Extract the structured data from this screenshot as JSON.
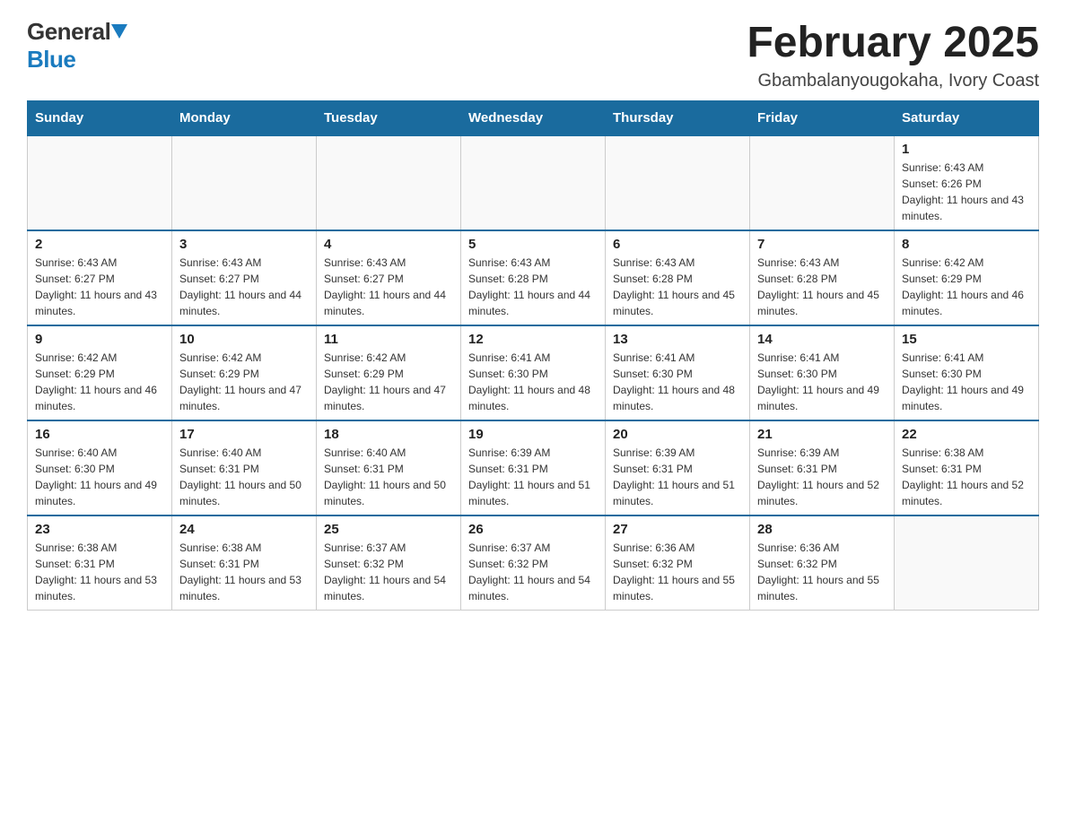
{
  "header": {
    "logo": {
      "general": "General",
      "blue": "Blue",
      "triangle_color": "#1a7bbf"
    },
    "title": "February 2025",
    "location": "Gbambalanyougokaha, Ivory Coast"
  },
  "calendar": {
    "days_of_week": [
      "Sunday",
      "Monday",
      "Tuesday",
      "Wednesday",
      "Thursday",
      "Friday",
      "Saturday"
    ],
    "weeks": [
      {
        "days": [
          {
            "date": "",
            "info": ""
          },
          {
            "date": "",
            "info": ""
          },
          {
            "date": "",
            "info": ""
          },
          {
            "date": "",
            "info": ""
          },
          {
            "date": "",
            "info": ""
          },
          {
            "date": "",
            "info": ""
          },
          {
            "date": "1",
            "info": "Sunrise: 6:43 AM\nSunset: 6:26 PM\nDaylight: 11 hours and 43 minutes."
          }
        ]
      },
      {
        "days": [
          {
            "date": "2",
            "info": "Sunrise: 6:43 AM\nSunset: 6:27 PM\nDaylight: 11 hours and 43 minutes."
          },
          {
            "date": "3",
            "info": "Sunrise: 6:43 AM\nSunset: 6:27 PM\nDaylight: 11 hours and 44 minutes."
          },
          {
            "date": "4",
            "info": "Sunrise: 6:43 AM\nSunset: 6:27 PM\nDaylight: 11 hours and 44 minutes."
          },
          {
            "date": "5",
            "info": "Sunrise: 6:43 AM\nSunset: 6:28 PM\nDaylight: 11 hours and 44 minutes."
          },
          {
            "date": "6",
            "info": "Sunrise: 6:43 AM\nSunset: 6:28 PM\nDaylight: 11 hours and 45 minutes."
          },
          {
            "date": "7",
            "info": "Sunrise: 6:43 AM\nSunset: 6:28 PM\nDaylight: 11 hours and 45 minutes."
          },
          {
            "date": "8",
            "info": "Sunrise: 6:42 AM\nSunset: 6:29 PM\nDaylight: 11 hours and 46 minutes."
          }
        ]
      },
      {
        "days": [
          {
            "date": "9",
            "info": "Sunrise: 6:42 AM\nSunset: 6:29 PM\nDaylight: 11 hours and 46 minutes."
          },
          {
            "date": "10",
            "info": "Sunrise: 6:42 AM\nSunset: 6:29 PM\nDaylight: 11 hours and 47 minutes."
          },
          {
            "date": "11",
            "info": "Sunrise: 6:42 AM\nSunset: 6:29 PM\nDaylight: 11 hours and 47 minutes."
          },
          {
            "date": "12",
            "info": "Sunrise: 6:41 AM\nSunset: 6:30 PM\nDaylight: 11 hours and 48 minutes."
          },
          {
            "date": "13",
            "info": "Sunrise: 6:41 AM\nSunset: 6:30 PM\nDaylight: 11 hours and 48 minutes."
          },
          {
            "date": "14",
            "info": "Sunrise: 6:41 AM\nSunset: 6:30 PM\nDaylight: 11 hours and 49 minutes."
          },
          {
            "date": "15",
            "info": "Sunrise: 6:41 AM\nSunset: 6:30 PM\nDaylight: 11 hours and 49 minutes."
          }
        ]
      },
      {
        "days": [
          {
            "date": "16",
            "info": "Sunrise: 6:40 AM\nSunset: 6:30 PM\nDaylight: 11 hours and 49 minutes."
          },
          {
            "date": "17",
            "info": "Sunrise: 6:40 AM\nSunset: 6:31 PM\nDaylight: 11 hours and 50 minutes."
          },
          {
            "date": "18",
            "info": "Sunrise: 6:40 AM\nSunset: 6:31 PM\nDaylight: 11 hours and 50 minutes."
          },
          {
            "date": "19",
            "info": "Sunrise: 6:39 AM\nSunset: 6:31 PM\nDaylight: 11 hours and 51 minutes."
          },
          {
            "date": "20",
            "info": "Sunrise: 6:39 AM\nSunset: 6:31 PM\nDaylight: 11 hours and 51 minutes."
          },
          {
            "date": "21",
            "info": "Sunrise: 6:39 AM\nSunset: 6:31 PM\nDaylight: 11 hours and 52 minutes."
          },
          {
            "date": "22",
            "info": "Sunrise: 6:38 AM\nSunset: 6:31 PM\nDaylight: 11 hours and 52 minutes."
          }
        ]
      },
      {
        "days": [
          {
            "date": "23",
            "info": "Sunrise: 6:38 AM\nSunset: 6:31 PM\nDaylight: 11 hours and 53 minutes."
          },
          {
            "date": "24",
            "info": "Sunrise: 6:38 AM\nSunset: 6:31 PM\nDaylight: 11 hours and 53 minutes."
          },
          {
            "date": "25",
            "info": "Sunrise: 6:37 AM\nSunset: 6:32 PM\nDaylight: 11 hours and 54 minutes."
          },
          {
            "date": "26",
            "info": "Sunrise: 6:37 AM\nSunset: 6:32 PM\nDaylight: 11 hours and 54 minutes."
          },
          {
            "date": "27",
            "info": "Sunrise: 6:36 AM\nSunset: 6:32 PM\nDaylight: 11 hours and 55 minutes."
          },
          {
            "date": "28",
            "info": "Sunrise: 6:36 AM\nSunset: 6:32 PM\nDaylight: 11 hours and 55 minutes."
          },
          {
            "date": "",
            "info": ""
          }
        ]
      }
    ]
  }
}
